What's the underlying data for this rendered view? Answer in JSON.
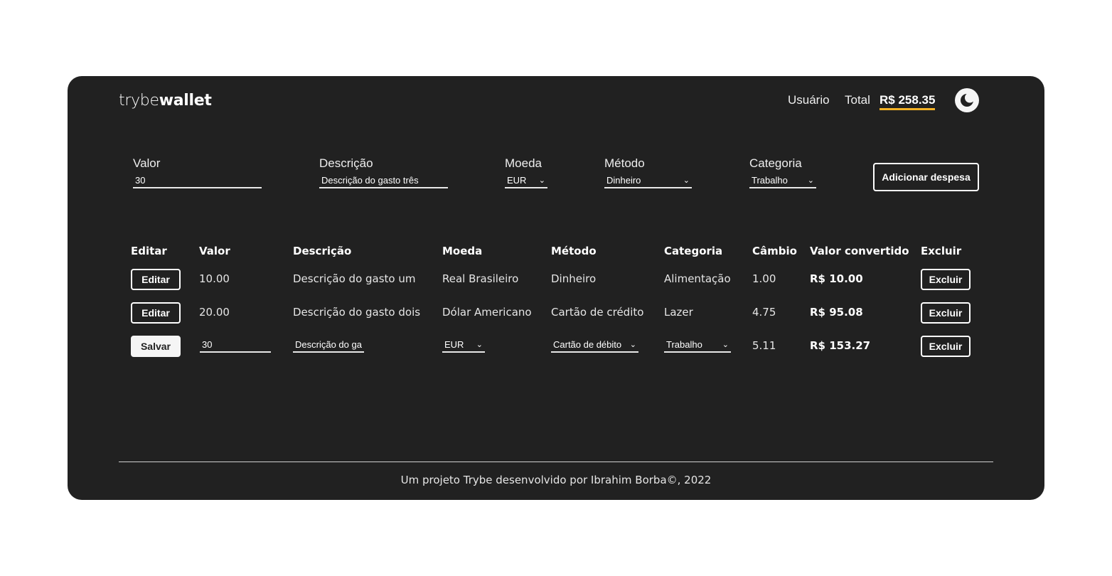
{
  "header": {
    "logo_light": "trybe",
    "logo_bold": "wallet",
    "user": "Usuário",
    "total_label": "Total",
    "total_value": "R$ 258.35",
    "accent_color": "#f5b324"
  },
  "form": {
    "valor_label": "Valor",
    "valor_value": "30",
    "descricao_label": "Descrição",
    "descricao_value": "Descrição do gasto três",
    "moeda_label": "Moeda",
    "moeda_value": "EUR",
    "metodo_label": "Método",
    "metodo_value": "Dinheiro",
    "categoria_label": "Categoria",
    "categoria_value": "Trabalho",
    "add_button": "Adicionar despesa"
  },
  "table": {
    "headers": [
      "Editar",
      "Valor",
      "Descrição",
      "Moeda",
      "Método",
      "Categoria",
      "Câmbio",
      "Valor convertido",
      "Excluir"
    ],
    "rows": [
      {
        "edit_label": "Editar",
        "valor": "10.00",
        "descricao": "Descrição do gasto um",
        "moeda": "Real Brasileiro",
        "metodo": "Dinheiro",
        "categoria": "Alimentação",
        "cambio": "1.00",
        "convertido": "R$ 10.00",
        "delete_label": "Excluir"
      },
      {
        "edit_label": "Editar",
        "valor": "20.00",
        "descricao": "Descrição do gasto dois",
        "moeda": "Dólar Americano",
        "metodo": "Cartão de crédito",
        "categoria": "Lazer",
        "cambio": "4.75",
        "convertido": "R$ 95.08",
        "delete_label": "Excluir"
      }
    ],
    "edit_row": {
      "save_label": "Salvar",
      "valor": "30",
      "descricao": "Descrição do ga",
      "moeda": "EUR",
      "metodo": "Cartão de débito",
      "categoria": "Trabalho",
      "cambio": "5.11",
      "convertido": "R$ 153.27",
      "delete_label": "Excluir"
    }
  },
  "footer": {
    "text": "Um projeto Trybe desenvolvido por Ibrahim Borba©, 2022"
  },
  "icons": {
    "theme": "moon-icon",
    "dropdown": "chevron-down-icon"
  }
}
